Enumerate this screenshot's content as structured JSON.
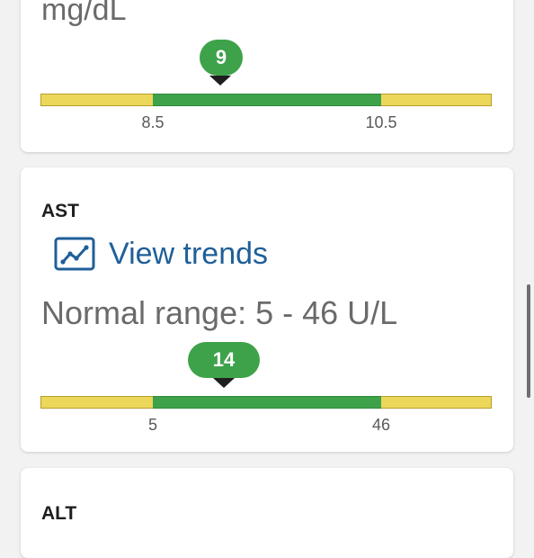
{
  "top_card": {
    "unit_text": "mg/dL",
    "value": "9",
    "low_label": "8.5",
    "high_label": "10.5"
  },
  "ast_card": {
    "name": "AST",
    "trends_label": "View trends",
    "trends_icon": "trend-chart-icon",
    "normal_range": "Normal range: 5 - 46 U/L",
    "value": "14",
    "low_label": "5",
    "high_label": "46"
  },
  "alt_card": {
    "name": "ALT"
  },
  "colors": {
    "in_range": "#3ea24a",
    "out_of_range": "#ecd75a",
    "link": "#1f5f99"
  }
}
